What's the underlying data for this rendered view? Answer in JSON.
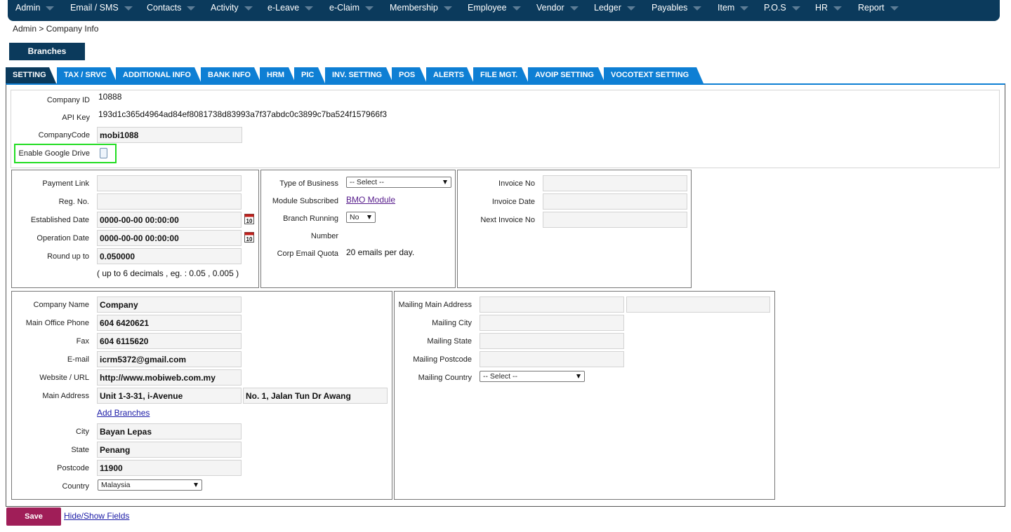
{
  "nav": [
    "Admin",
    "Email / SMS",
    "Contacts",
    "Activity",
    "e-Leave",
    "e-Claim",
    "Membership",
    "Employee",
    "Vendor",
    "Ledger",
    "Payables",
    "Item",
    "P.O.S",
    "HR",
    "Report"
  ],
  "breadcrumb": "Admin > Company Info",
  "branches_button": "Branches",
  "tabs": [
    "SETTING",
    "TAX / SRVC",
    "ADDITIONAL INFO",
    "BANK INFO",
    "HRM",
    "PIC",
    "INV. SETTING",
    "POS",
    "ALERTS",
    "FILE MGT.",
    "AVOIP SETTING",
    "VOCOTEXT SETTING"
  ],
  "top": {
    "company_id_label": "Company ID",
    "company_id": "10888",
    "api_key_label": "API Key",
    "api_key": "193d1c365d4964ad84ef8081738d83993a7f37abdc0c3899c7ba524f157966f3",
    "company_code_label": "CompanyCode",
    "company_code": "mobi1088",
    "google_drive_label": "Enable Google Drive"
  },
  "left": {
    "payment_link_label": "Payment Link",
    "payment_link": "",
    "reg_no_label": "Reg. No.",
    "reg_no": "",
    "established_label": "Established Date",
    "established": "0000-00-00 00:00:00",
    "operation_label": "Operation Date",
    "operation": "0000-00-00 00:00:00",
    "roundup_label": "Round up to",
    "roundup": "0.050000",
    "roundup_hint": "( up to 6 decimals , eg. : 0.05 , 0.005 )"
  },
  "middle": {
    "business_label": "Type of Business",
    "business_value": "-- Select --",
    "module_label": "Module Subscribed",
    "module_link": "BMO Module",
    "branch_label": "Branch Running",
    "branch_value": "No",
    "number_label": "Number",
    "quota_label": "Corp Email Quota",
    "quota_value": "20 emails per day."
  },
  "invoice": {
    "invoice_no_label": "Invoice No",
    "invoice_date_label": "Invoice Date",
    "next_invoice_label": "Next Invoice No"
  },
  "contact": {
    "company_name_label": "Company Name",
    "company_name": "Company",
    "phone_label": "Main Office Phone",
    "phone": "604 6420621",
    "fax_label": "Fax",
    "fax": "604 6115620",
    "email_label": "E-mail",
    "email": "icrm5372@gmail.com",
    "website_label": "Website / URL",
    "website": "http://www.mobiweb.com.my",
    "address_label": "Main Address",
    "address1": "Unit 1-3-31, i-Avenue",
    "address2": "No. 1, Jalan Tun Dr Awang",
    "add_branches": "Add Branches",
    "city_label": "City",
    "city": "Bayan Lepas",
    "state_label": "State",
    "state": "Penang",
    "postcode_label": "Postcode",
    "postcode": "11900",
    "country_label": "Country",
    "country": "Malaysia"
  },
  "mailing": {
    "main_address_label": "Mailing Main Address",
    "city_label": "Mailing City",
    "state_label": "Mailing State",
    "postcode_label": "Mailing Postcode",
    "country_label": "Mailing Country",
    "country_value": "-- Select --"
  },
  "footer": {
    "save": "Save",
    "hide_show": "Hide/Show Fields"
  },
  "colors": {
    "nav_bg": "#0b3a5c",
    "tab_blue": "#0e7fd4",
    "save_bg": "#a01e58",
    "highlight": "#22dd22"
  }
}
